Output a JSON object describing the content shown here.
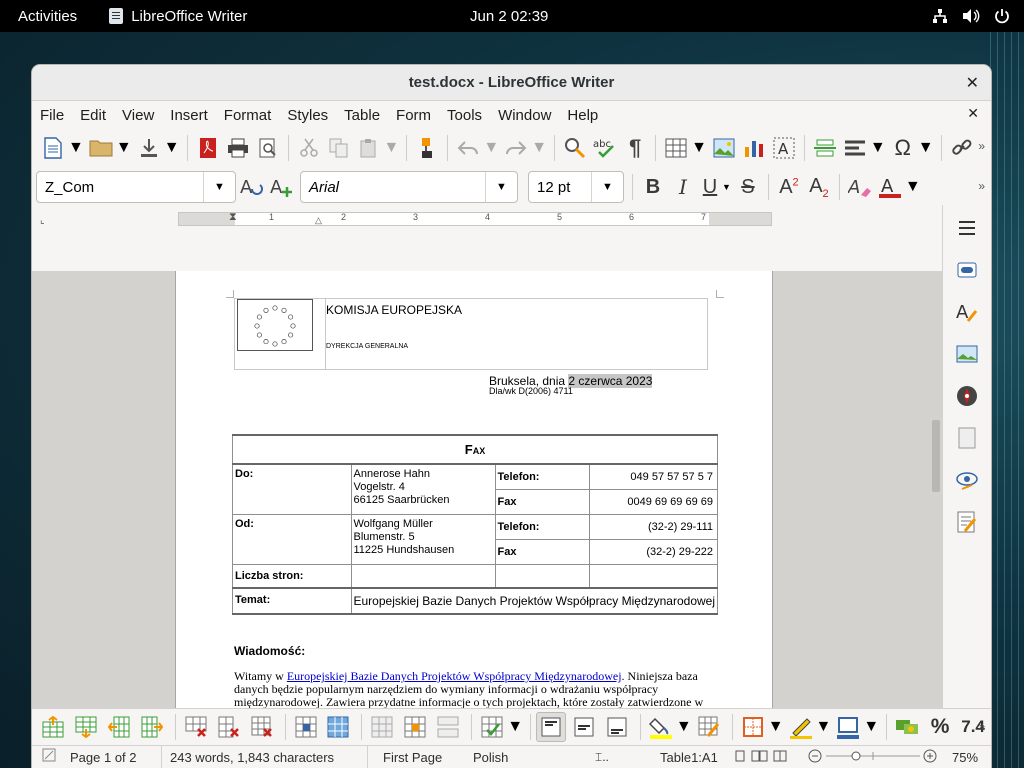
{
  "topbar": {
    "activities": "Activities",
    "app_name": "LibreOffice Writer",
    "clock": "Jun 2  02:39"
  },
  "window": {
    "title": "test.docx - LibreOffice Writer"
  },
  "menu": [
    "File",
    "Edit",
    "View",
    "Insert",
    "Format",
    "Styles",
    "Table",
    "Form",
    "Tools",
    "Window",
    "Help"
  ],
  "format": {
    "paragraph_style": "Z_Com",
    "font_name": "Arial",
    "font_size": "12 pt"
  },
  "ruler": {
    "numbers": [
      "1",
      "2",
      "3",
      "4",
      "5",
      "6",
      "7"
    ]
  },
  "document": {
    "org": "KOMISJA EUROPEJSKA",
    "dept": "DYREKCJA GENERALNA",
    "date_prefix": "Bruksela, dnia ",
    "date_value": "2 czerwca 2023",
    "ref": "Dla/wk D(2006) 4711",
    "fax": {
      "title": "Fax",
      "to_label": "Do:",
      "to_lines": [
        "Annerose Hahn",
        "Vogelstr. 4",
        "66125 Saarbrücken"
      ],
      "to_phone_label": "Telefon:",
      "to_phone": "049 57 57 57 5 7",
      "to_fax_label": "Fax",
      "to_fax": "0049 69 69 69 69",
      "from_label": "Od:",
      "from_lines": [
        "Wolfgang Müller",
        "Blumenstr. 5",
        "11225 Hundshausen"
      ],
      "from_phone_label": "Telefon:",
      "from_phone": "(32-2) 29-111",
      "from_fax_label": "Fax",
      "from_fax": "(32-2) 29-222",
      "pages_label": "Liczba stron:",
      "subject_label": "Temat:",
      "subject": "Europejskiej Bazie Danych Projektów Współpracy Międzynarodowej"
    },
    "message_heading": "Wiadomość:",
    "message_start": "Witamy w ",
    "message_link": "Europejskiej Bazie Danych Projektów Współpracy Międzynarodowej",
    "message_rest": ". Niniejsza baza danych będzie popularnym narzędziem do wymiany informacji o wdrażaniu współpracy międzynarodowej. Zawiera przydatne informacje o tych projektach, które zostały zatwierdzone w"
  },
  "toolbar": {
    "number_format": "7.4",
    "percent": "%"
  },
  "status": {
    "page": "Page 1 of 2",
    "words": "243 words, 1,843 characters",
    "page_style": "First Page",
    "language": "Polish",
    "cell": "Table1:A1",
    "zoom": "75%"
  },
  "colors": {
    "highlight_yellow": "#ffff00",
    "font_color_red": "#c9211e",
    "link_blue": "#0000cc"
  }
}
